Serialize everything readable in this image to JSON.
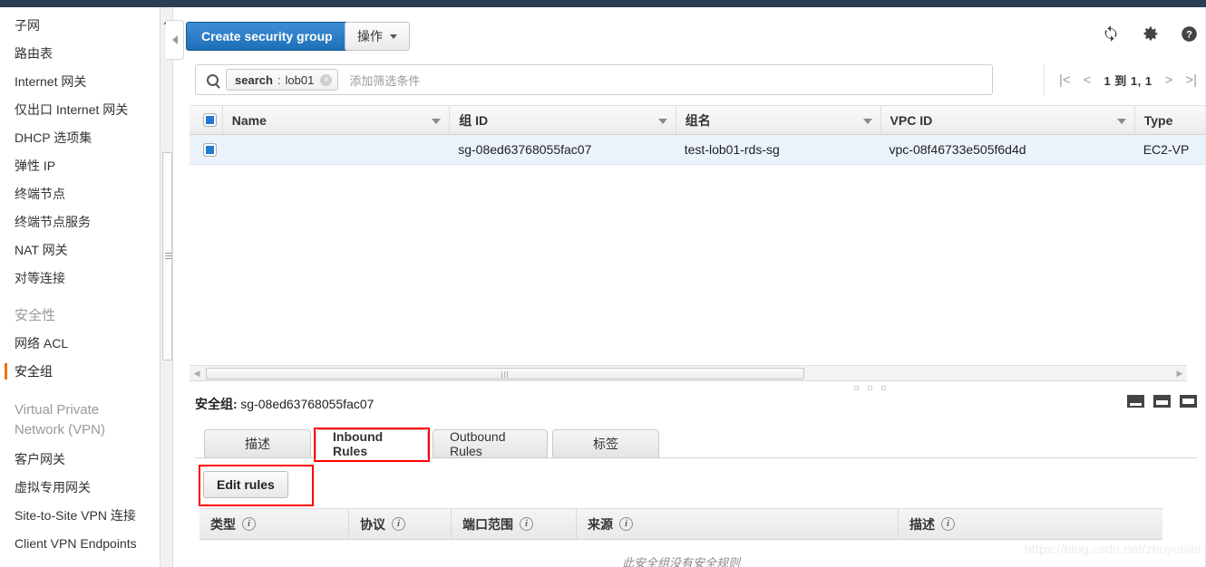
{
  "sidebar": {
    "items": [
      {
        "label": "子网",
        "type": "link",
        "active": false
      },
      {
        "label": "路由表",
        "type": "link",
        "active": false
      },
      {
        "label": "Internet 网关",
        "type": "link",
        "active": false
      },
      {
        "label": "仅出口 Internet 网关",
        "type": "link",
        "active": false
      },
      {
        "label": "DHCP 选项集",
        "type": "link",
        "active": false
      },
      {
        "label": "弹性 IP",
        "type": "link",
        "active": false
      },
      {
        "label": "终端节点",
        "type": "link",
        "active": false
      },
      {
        "label": "终端节点服务",
        "type": "link",
        "active": false
      },
      {
        "label": "NAT 网关",
        "type": "link",
        "active": false
      },
      {
        "label": "对等连接",
        "type": "link",
        "active": false
      },
      {
        "label": "安全性",
        "type": "section",
        "active": false
      },
      {
        "label": "网络 ACL",
        "type": "link",
        "active": false
      },
      {
        "label": "安全组",
        "type": "link",
        "active": true
      },
      {
        "label": "Virtual Private Network (VPN)",
        "type": "section",
        "active": false
      },
      {
        "label": "客户网关",
        "type": "link",
        "active": false
      },
      {
        "label": "虚拟专用网关",
        "type": "link",
        "active": false
      },
      {
        "label": "Site-to-Site VPN 连接",
        "type": "link",
        "active": false
      },
      {
        "label": "Client VPN Endpoints",
        "type": "link",
        "active": false
      }
    ]
  },
  "toolbar": {
    "create_label": "Create security group",
    "actions_label": "操作",
    "refresh_icon": "refresh-icon",
    "settings_icon": "gear-icon",
    "help_icon": "help-icon"
  },
  "search": {
    "icon": "search-icon",
    "token_key": "search",
    "token_sep": ":",
    "token_value": "lob01",
    "remove_icon": "close-icon",
    "placeholder": "添加筛选条件"
  },
  "pagination": {
    "first": "|<",
    "prev": "<",
    "count": "1 到 1, 1",
    "next": ">",
    "last": ">|"
  },
  "table": {
    "columns": [
      "Name",
      "组 ID",
      "组名",
      "VPC ID",
      "Type"
    ],
    "rows": [
      {
        "selected": true,
        "name": "",
        "group_id": "sg-08ed63768055fac07",
        "group_name": "test-lob01-rds-sg",
        "vpc_id": "vpc-08f46733e505f6d4d",
        "type": "EC2-VP"
      }
    ]
  },
  "detail": {
    "label": "安全组:",
    "value": "sg-08ed63768055fac07",
    "tabs": [
      {
        "label": "描述",
        "active": false
      },
      {
        "label": "Inbound Rules",
        "active": true
      },
      {
        "label": "Outbound Rules",
        "active": false
      },
      {
        "label": "标签",
        "active": false
      }
    ],
    "edit_label": "Edit rules",
    "rules_columns": [
      "类型",
      "协议",
      "端口范围",
      "来源",
      "描述"
    ],
    "empty_message": "此安全组没有安全规则"
  },
  "watermark": "https://blog.csdn.net/zhuyunier",
  "colors": {
    "accent_orange": "#ec7211",
    "primary_blue": "#1d6fb8",
    "highlight_red": "#ff0000",
    "row_selected": "#eaf2fb",
    "topbar": "#2a3f54"
  }
}
